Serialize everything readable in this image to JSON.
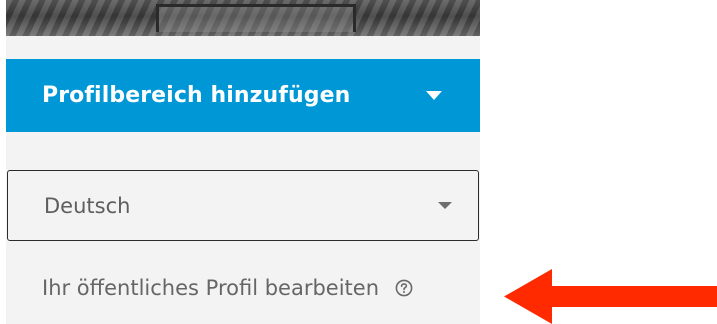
{
  "sidebar": {
    "add_section_label": "Profilbereich hinzufügen",
    "language_select": {
      "value": "Deutsch"
    },
    "public_profile_link": "Ihr öffentliches Profil bearbeiten"
  },
  "icons": {
    "add_section_caret": "chevron-down-icon",
    "language_caret": "chevron-down-icon",
    "help": "help-icon",
    "annotation": "arrow-left-icon"
  },
  "colors": {
    "primary": "#0097d6",
    "panel_bg": "#f3f3f3",
    "annotation_arrow": "#ff2a00",
    "text_muted": "#666666"
  }
}
